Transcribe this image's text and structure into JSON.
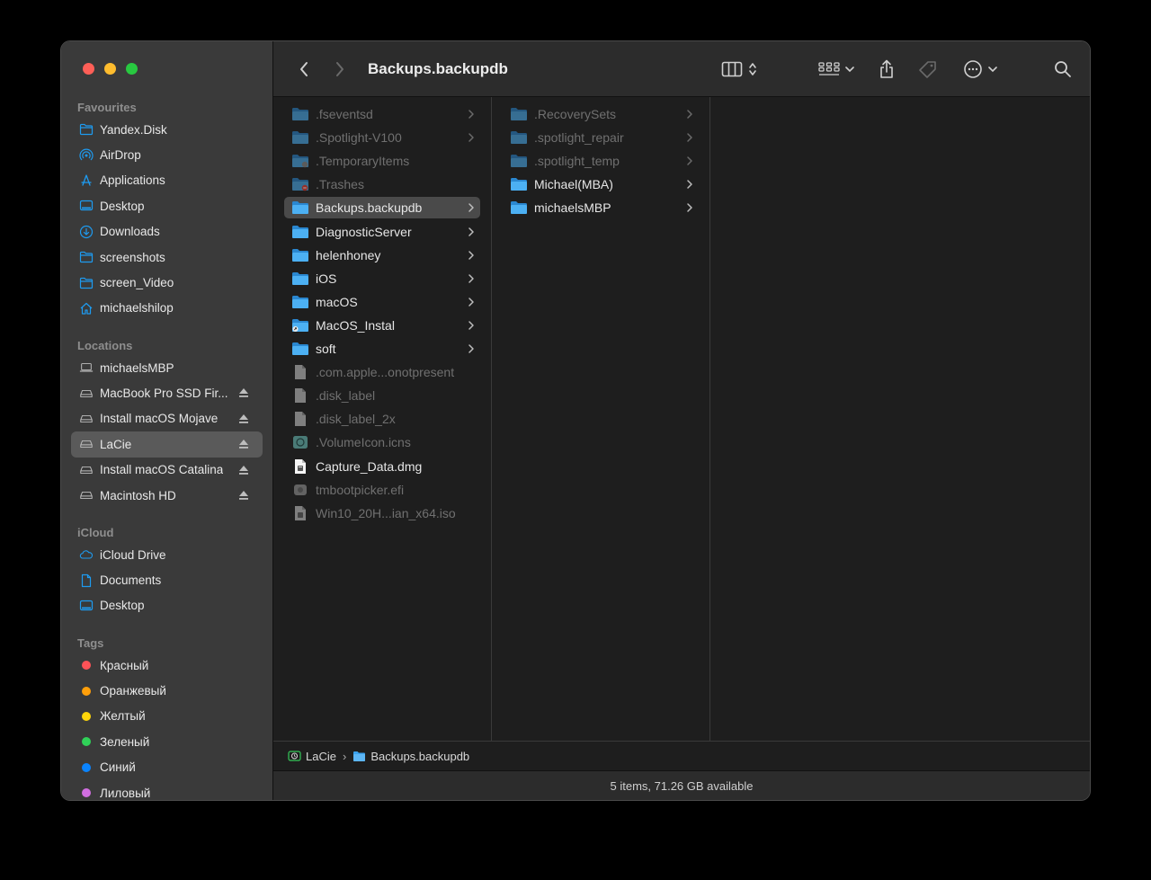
{
  "window": {
    "title": "Backups.backupdb"
  },
  "sidebar": {
    "favourites_heading": "Favourites",
    "favourites": [
      {
        "label": "Yandex.Disk",
        "icon": "folder-icon"
      },
      {
        "label": "AirDrop",
        "icon": "airdrop-icon"
      },
      {
        "label": "Applications",
        "icon": "applications-icon"
      },
      {
        "label": "Desktop",
        "icon": "desktop-icon"
      },
      {
        "label": "Downloads",
        "icon": "downloads-icon"
      },
      {
        "label": "screenshots",
        "icon": "folder-icon"
      },
      {
        "label": "screen_Video",
        "icon": "folder-icon"
      },
      {
        "label": "michaelshilop",
        "icon": "home-icon"
      }
    ],
    "locations_heading": "Locations",
    "locations": [
      {
        "label": "michaelsMBP",
        "icon": "laptop-icon",
        "eject": false
      },
      {
        "label": "MacBook Pro SSD Fir...",
        "icon": "drive-icon",
        "eject": true
      },
      {
        "label": "Install macOS Mojave",
        "icon": "drive-icon",
        "eject": true
      },
      {
        "label": "LaCie",
        "icon": "drive-icon",
        "eject": true,
        "selected": true
      },
      {
        "label": "Install macOS Catalina",
        "icon": "drive-icon",
        "eject": true
      },
      {
        "label": "Macintosh HD",
        "icon": "drive-icon",
        "eject": true
      }
    ],
    "icloud_heading": "iCloud",
    "icloud": [
      {
        "label": "iCloud Drive",
        "icon": "cloud-icon"
      },
      {
        "label": "Documents",
        "icon": "document-icon"
      },
      {
        "label": "Desktop",
        "icon": "desktop-icon"
      }
    ],
    "tags_heading": "Tags",
    "tags": [
      {
        "label": "Красный",
        "color": "#ff5257"
      },
      {
        "label": "Оранжевый",
        "color": "#ff9f0a"
      },
      {
        "label": "Желтый",
        "color": "#ffd60a"
      },
      {
        "label": "Зеленый",
        "color": "#30d158"
      },
      {
        "label": "Синий",
        "color": "#0a84ff"
      },
      {
        "label": "Лиловый",
        "color": "#d16ee0"
      }
    ]
  },
  "column1": [
    {
      "label": ".fseventsd",
      "kind": "folder",
      "dim": true,
      "chevron": true
    },
    {
      "label": ".Spotlight-V100",
      "kind": "folder",
      "dim": true,
      "chevron": true
    },
    {
      "label": ".TemporaryItems",
      "kind": "folder-badge",
      "dim": true,
      "chevron": false
    },
    {
      "label": ".Trashes",
      "kind": "folder-trash",
      "dim": true,
      "chevron": false
    },
    {
      "label": "Backups.backupdb",
      "kind": "folder",
      "dim": false,
      "chevron": true,
      "selected": true
    },
    {
      "label": "DiagnosticServer",
      "kind": "folder",
      "dim": false,
      "chevron": true
    },
    {
      "label": "helenhoney",
      "kind": "folder",
      "dim": false,
      "chevron": true
    },
    {
      "label": "iOS",
      "kind": "folder",
      "dim": false,
      "chevron": true
    },
    {
      "label": "macOS",
      "kind": "folder",
      "dim": false,
      "chevron": true
    },
    {
      "label": "MacOS_Instal",
      "kind": "folder-alias",
      "dim": false,
      "chevron": true
    },
    {
      "label": "soft",
      "kind": "folder",
      "dim": false,
      "chevron": true
    },
    {
      "label": ".com.apple...onotpresent",
      "kind": "file",
      "dim": true,
      "chevron": false
    },
    {
      "label": ".disk_label",
      "kind": "file",
      "dim": true,
      "chevron": false
    },
    {
      "label": ".disk_label_2x",
      "kind": "file",
      "dim": true,
      "chevron": false
    },
    {
      "label": ".VolumeIcon.icns",
      "kind": "icns",
      "dim": true,
      "chevron": false
    },
    {
      "label": "Capture_Data.dmg",
      "kind": "dmg",
      "dim": false,
      "chevron": false
    },
    {
      "label": "tmbootpicker.efi",
      "kind": "exec",
      "dim": true,
      "chevron": false
    },
    {
      "label": "Win10_20H...ian_x64.iso",
      "kind": "iso",
      "dim": true,
      "chevron": false
    }
  ],
  "column2": [
    {
      "label": ".RecoverySets",
      "kind": "folder",
      "dim": true,
      "chevron": true
    },
    {
      "label": ".spotlight_repair",
      "kind": "folder",
      "dim": true,
      "chevron": true
    },
    {
      "label": ".spotlight_temp",
      "kind": "folder",
      "dim": true,
      "chevron": true
    },
    {
      "label": "Michael(MBA)",
      "kind": "folder",
      "dim": false,
      "chevron": true
    },
    {
      "label": "michaelsMBP",
      "kind": "folder",
      "dim": false,
      "chevron": true
    }
  ],
  "pathbar": {
    "items": [
      {
        "label": "LaCie",
        "icon": "timemachine-drive-icon"
      },
      {
        "label": "Backups.backupdb",
        "icon": "folder-icon"
      }
    ],
    "separator": "›"
  },
  "status": {
    "text": "5 items, 71.26 GB available"
  },
  "colors": {
    "accent": "#1e9bf0",
    "folder": "#3aa2ee"
  }
}
